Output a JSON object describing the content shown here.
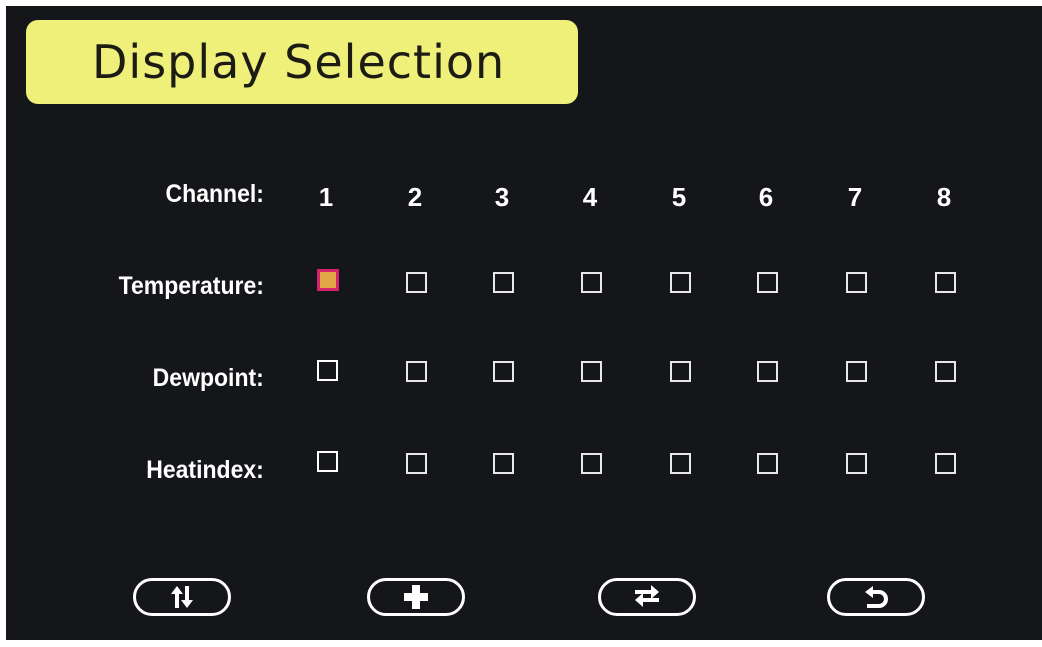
{
  "title": "Display Selection",
  "channel_label": "Channel:",
  "channels": [
    "1",
    "2",
    "3",
    "4",
    "5",
    "6",
    "7",
    "8"
  ],
  "rows": [
    {
      "label": "Temperature:",
      "checked": [
        true,
        false,
        false,
        false,
        false,
        false,
        false,
        false
      ],
      "focused_channel": "1"
    },
    {
      "label": "Dewpoint:",
      "checked": [
        false,
        false,
        false,
        false,
        false,
        false,
        false,
        false
      ]
    },
    {
      "label": "Heatindex:",
      "checked": [
        false,
        false,
        false,
        false,
        false,
        false,
        false,
        false
      ]
    }
  ],
  "buttons": [
    {
      "icon": "up-down-arrows-icon"
    },
    {
      "icon": "plus-icon"
    },
    {
      "icon": "swap-arrows-icon"
    },
    {
      "icon": "return-arrow-icon"
    }
  ],
  "colors": {
    "background": "#14161a",
    "title_bar": "#eef07a",
    "title_text": "#1c1c14",
    "text": "#ffffff",
    "selected_fill": "#e0a848",
    "selected_border": "#d4246c"
  }
}
